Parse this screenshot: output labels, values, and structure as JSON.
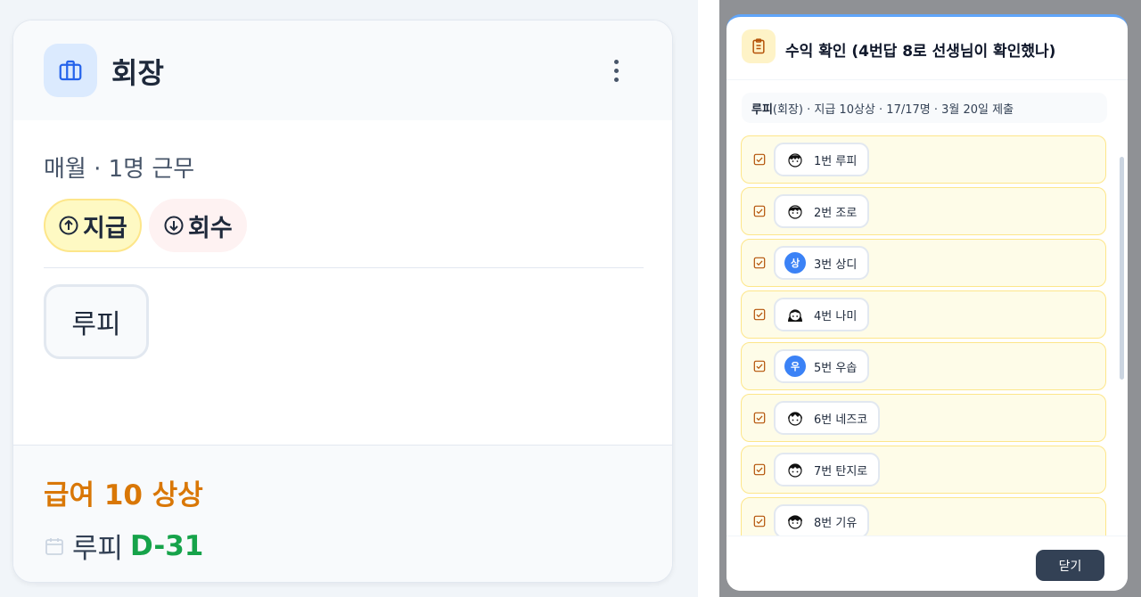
{
  "card": {
    "title": "회장",
    "role_icon": "briefcase-icon",
    "schedule": "매월 · 1명 근무",
    "tags": [
      {
        "label": "지급",
        "icon": "arrow-up-circle-icon",
        "color": "#fef9c3"
      },
      {
        "label": "회수",
        "icon": "arrow-down-circle-icon",
        "color": "#fef2f2"
      }
    ],
    "member": "루피",
    "salary": "급여 10 상상",
    "due_name": "루피",
    "due_dday": "D-31"
  },
  "modal": {
    "title": "수익 확인 (4번답 8로 선생님이 확인했나)",
    "icon": "clipboard-icon",
    "summary_name": "루피",
    "summary_rest": " (회장) · 지급 10상상 · 17/17명 · 3월 20일 제출",
    "items": [
      {
        "label": "1번 루피",
        "avatar": "face"
      },
      {
        "label": "2번 조로",
        "avatar": "face"
      },
      {
        "label": "3번 상디",
        "avatar": "letter",
        "initial": "상"
      },
      {
        "label": "4번 나미",
        "avatar": "face"
      },
      {
        "label": "5번 우솝",
        "avatar": "letter",
        "initial": "우"
      },
      {
        "label": "6번 네즈코",
        "avatar": "face"
      },
      {
        "label": "7번 탄지로",
        "avatar": "face"
      },
      {
        "label": "8번 기유",
        "avatar": "face"
      }
    ],
    "close_label": "닫기"
  },
  "colors": {
    "accent_blue": "#3b82f6",
    "salary_orange": "#d97706",
    "dday_green": "#16a34a",
    "item_bg": "#fefce8"
  }
}
